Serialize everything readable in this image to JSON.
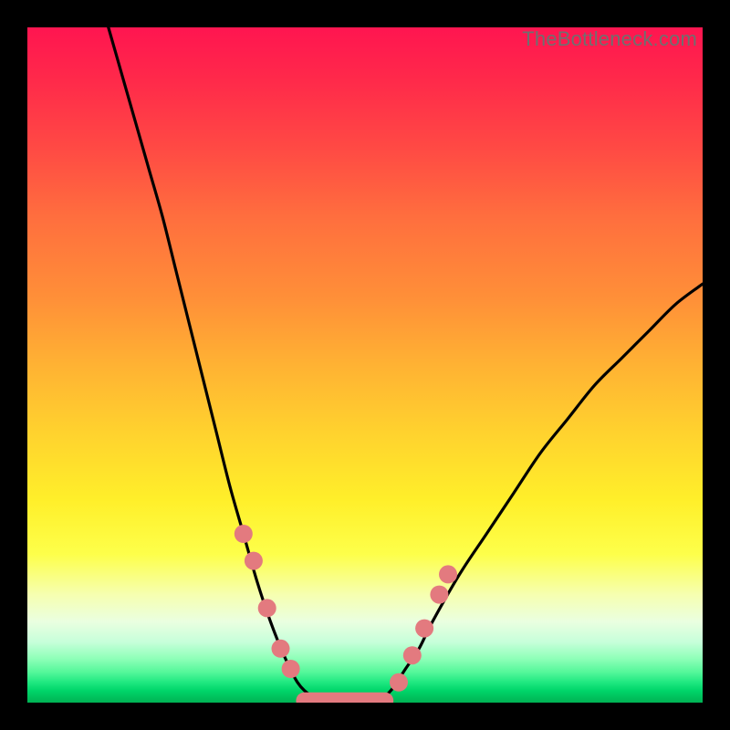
{
  "watermark": "TheBottleneck.com",
  "chart_data": {
    "type": "line",
    "title": "",
    "xlabel": "",
    "ylabel": "",
    "xlim": [
      0,
      100
    ],
    "ylim": [
      0,
      100
    ],
    "curve_left": {
      "name": "left-branch",
      "x": [
        12,
        14,
        16,
        18,
        20,
        22,
        24,
        26,
        28,
        30,
        32,
        34,
        36,
        38,
        40,
        42,
        44
      ],
      "y": [
        100,
        93,
        86,
        79,
        72,
        64,
        56,
        48,
        40,
        32,
        25,
        18,
        12,
        7,
        3,
        1,
        0
      ]
    },
    "curve_right": {
      "name": "right-branch",
      "x": [
        52,
        54,
        56,
        58,
        60,
        64,
        68,
        72,
        76,
        80,
        84,
        88,
        92,
        96,
        100
      ],
      "y": [
        0,
        2,
        5,
        8,
        12,
        19,
        25,
        31,
        37,
        42,
        47,
        51,
        55,
        59,
        62
      ]
    },
    "flat": {
      "name": "trough",
      "x": [
        44,
        52
      ],
      "y": [
        0,
        0
      ]
    },
    "markers_left": {
      "name": "markers-left",
      "color": "#e37a7f",
      "points": [
        {
          "x": 32.0,
          "y": 25
        },
        {
          "x": 33.5,
          "y": 21
        },
        {
          "x": 35.5,
          "y": 14
        },
        {
          "x": 37.5,
          "y": 8
        },
        {
          "x": 39.0,
          "y": 5
        }
      ]
    },
    "markers_right": {
      "name": "markers-right",
      "color": "#e37a7f",
      "points": [
        {
          "x": 55.0,
          "y": 3
        },
        {
          "x": 57.0,
          "y": 7
        },
        {
          "x": 58.8,
          "y": 11
        },
        {
          "x": 61.0,
          "y": 16
        },
        {
          "x": 62.3,
          "y": 19
        }
      ]
    },
    "trough_band": {
      "color": "#e37a7f",
      "x_start": 41,
      "x_end": 53,
      "y": 0.3,
      "thickness": 2.5
    }
  }
}
